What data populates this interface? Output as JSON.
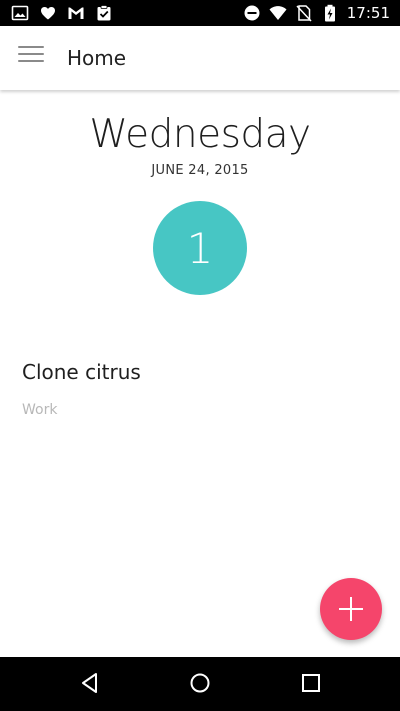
{
  "status_bar": {
    "time": "17:51",
    "left_icons": [
      "image-icon",
      "heart-icon",
      "gmail-icon",
      "clipboard-check-icon"
    ],
    "right_icons": [
      "do-not-disturb-icon",
      "wifi-icon",
      "no-sim-icon",
      "battery-charging-icon"
    ]
  },
  "app_bar": {
    "title": "Home",
    "menu_icon": "menu-icon"
  },
  "day": {
    "name": "Wednesday",
    "date": "JUNE 24, 2015",
    "count": "1",
    "circle_color": "#47c6c4"
  },
  "tasks": [
    {
      "title": "Clone citrus",
      "tag": "Work"
    }
  ],
  "fab": {
    "icon": "plus-icon",
    "color": "#f5456b"
  },
  "nav_bar": {
    "buttons": [
      "back-icon",
      "home-icon",
      "recents-icon"
    ]
  }
}
